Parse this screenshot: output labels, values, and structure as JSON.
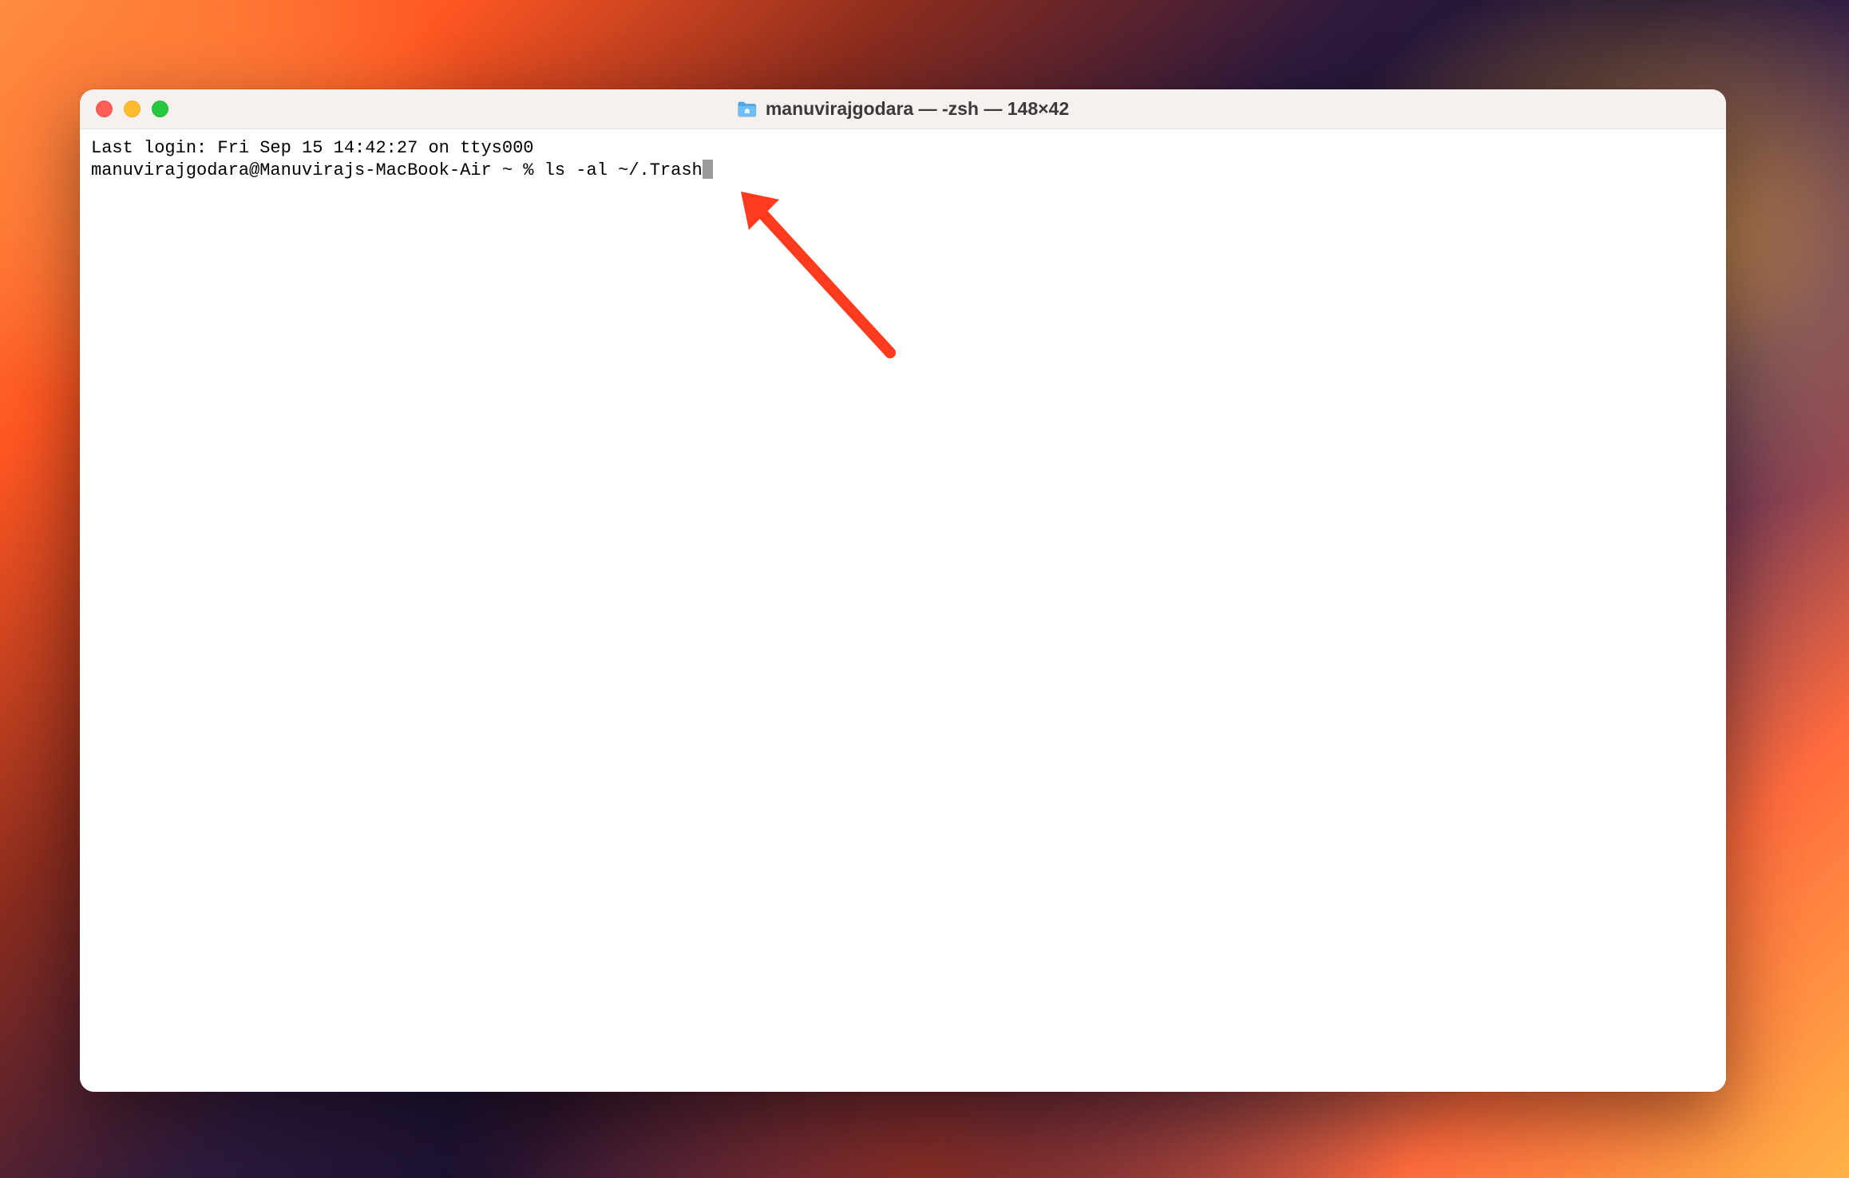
{
  "window": {
    "title": "manuvirajgodara — -zsh — 148×42"
  },
  "terminal": {
    "last_login_line": "Last login: Fri Sep 15 14:42:27 on ttys000",
    "prompt": "manuvirajgodara@Manuvirajs-MacBook-Air ~ % ",
    "command": "ls -al ~/.Trash"
  }
}
